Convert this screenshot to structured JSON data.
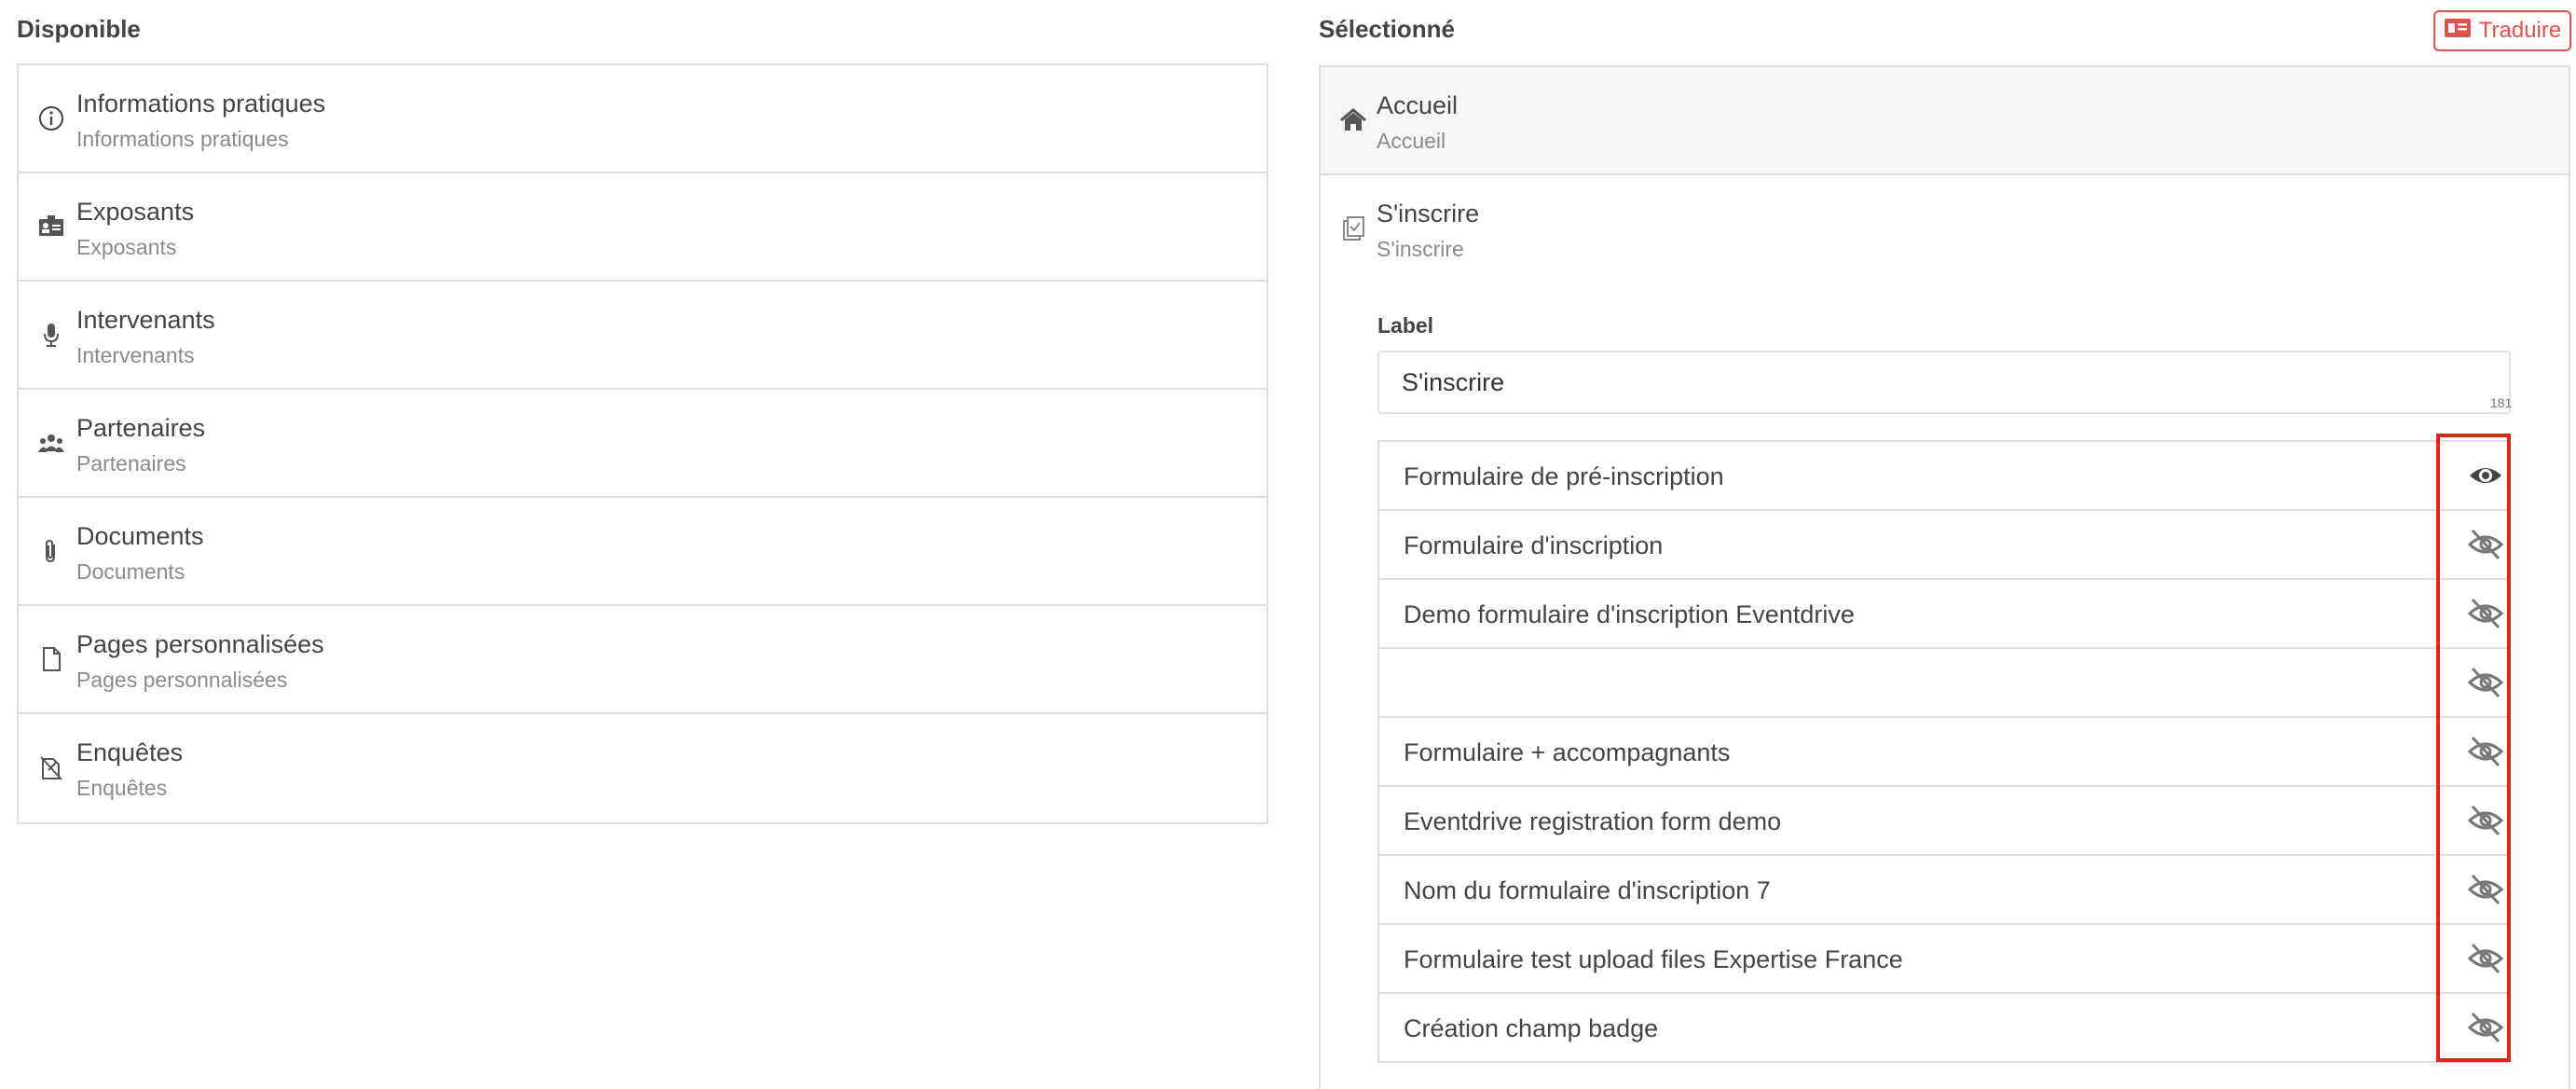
{
  "available": {
    "heading": "Disponible",
    "items": [
      {
        "title": "Informations pratiques",
        "subtitle": "Informations pratiques",
        "icon": "info-circle-icon"
      },
      {
        "title": "Exposants",
        "subtitle": "Exposants",
        "icon": "id-card-icon"
      },
      {
        "title": "Intervenants",
        "subtitle": "Intervenants",
        "icon": "microphone-icon"
      },
      {
        "title": "Partenaires",
        "subtitle": "Partenaires",
        "icon": "users-icon"
      },
      {
        "title": "Documents",
        "subtitle": "Documents",
        "icon": "paperclip-icon"
      },
      {
        "title": "Pages personnalisées",
        "subtitle": "Pages personnalisées",
        "icon": "file-icon"
      },
      {
        "title": "Enquêtes",
        "subtitle": "Enquêtes",
        "icon": "survey-icon"
      }
    ]
  },
  "selected": {
    "heading": "Sélectionné",
    "translate_label": "Traduire",
    "items": [
      {
        "title": "Accueil",
        "subtitle": "Accueil",
        "icon": "home-icon"
      },
      {
        "title": "S'inscrire",
        "subtitle": "S'inscrire",
        "icon": "register-icon"
      }
    ],
    "label_title": "Label",
    "label_value": "S'inscrire",
    "char_count": "181",
    "forms": [
      {
        "name": "Formulaire de pré-inscription",
        "visible": true
      },
      {
        "name": "Formulaire d'inscription",
        "visible": false
      },
      {
        "name": "Demo formulaire d'inscription Eventdrive",
        "visible": false
      },
      {
        "name": "",
        "visible": false
      },
      {
        "name": "Formulaire + accompagnants",
        "visible": false
      },
      {
        "name": "Eventdrive registration form demo",
        "visible": false
      },
      {
        "name": "Nom du formulaire d'inscription 7",
        "visible": false
      },
      {
        "name": "Formulaire test upload files Expertise France",
        "visible": false
      },
      {
        "name": "Création champ badge",
        "visible": false
      }
    ]
  },
  "colors": {
    "accent": "#e0524b",
    "highlight": "#e0251b",
    "border": "#dddddd"
  }
}
